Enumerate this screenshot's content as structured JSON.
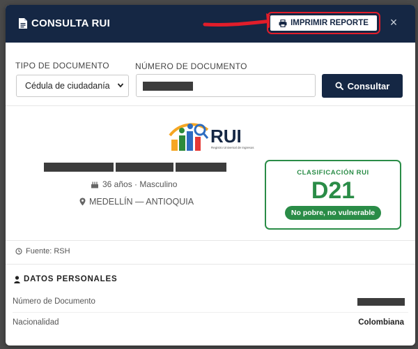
{
  "modal": {
    "title": "CONSULTA RUI",
    "print_label": "IMPRIMIR REPORTE",
    "close_glyph": "×"
  },
  "form": {
    "doc_type_label": "TIPO DE DOCUMENTO",
    "doc_type_value": "Cédula de ciudadanía",
    "doc_number_label": "NÚMERO DE DOCUMENTO",
    "consult_label": "Consultar"
  },
  "logo": {
    "text": "RUI",
    "subtitle": "Registro Universal de Ingresos"
  },
  "person": {
    "age_gender": "36 años · Masculino",
    "location": "MEDELLÍN — ANTIOQUIA"
  },
  "classification": {
    "title": "CLASIFICACIÓN RUI",
    "code": "D21",
    "description": "No pobre, no vulnerable"
  },
  "source": {
    "text": "Fuente: RSH"
  },
  "personal": {
    "title": "DATOS PERSONALES",
    "rows": [
      {
        "label": "Número de Documento",
        "value": ""
      },
      {
        "label": "Nacionalidad",
        "value": "Colombiana"
      }
    ]
  },
  "colors": {
    "navy": "#152744",
    "green": "#2a8c47",
    "highlight": "#e11d2a"
  },
  "icons": [
    "document-icon",
    "printer-icon",
    "close-icon",
    "search-icon",
    "chevron-down-icon",
    "cake-icon",
    "map-pin-icon",
    "clock-icon",
    "user-icon",
    "red-arrow-annotation"
  ]
}
